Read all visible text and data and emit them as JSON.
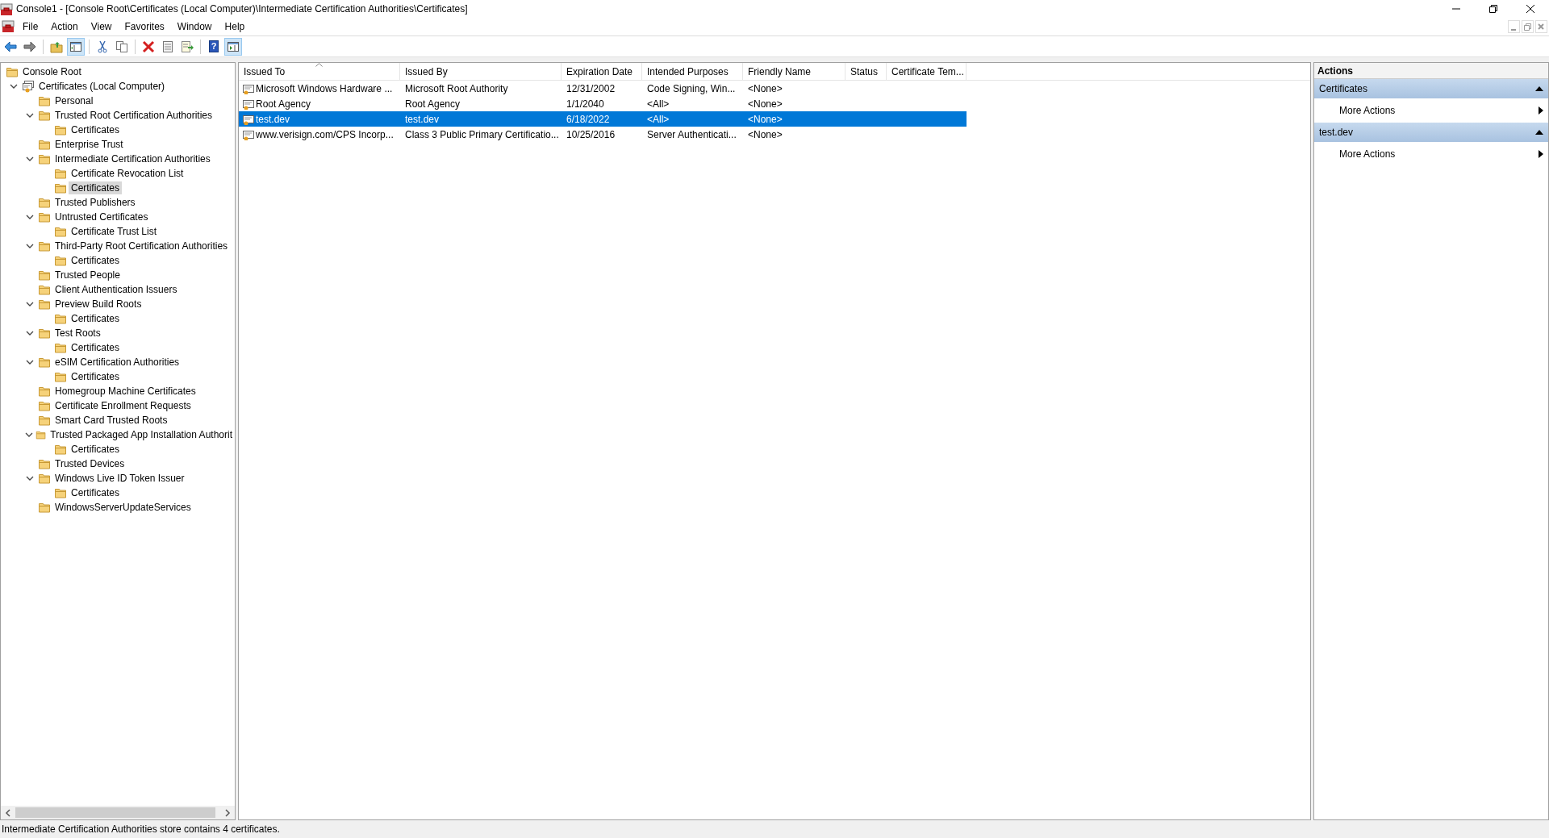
{
  "window": {
    "title": "Console1 - [Console Root\\Certificates (Local Computer)\\Intermediate Certification Authorities\\Certificates]"
  },
  "menu": [
    "File",
    "Action",
    "View",
    "Favorites",
    "Window",
    "Help"
  ],
  "toolbar": [
    {
      "kind": "back",
      "pressed": false
    },
    {
      "kind": "forward",
      "pressed": false
    },
    {
      "kind": "separator"
    },
    {
      "kind": "up",
      "pressed": false
    },
    {
      "kind": "tree",
      "pressed": true
    },
    {
      "kind": "separator"
    },
    {
      "kind": "cut",
      "pressed": false
    },
    {
      "kind": "copy",
      "pressed": false
    },
    {
      "kind": "separator"
    },
    {
      "kind": "delete",
      "pressed": false
    },
    {
      "kind": "properties",
      "pressed": false
    },
    {
      "kind": "export",
      "pressed": false
    },
    {
      "kind": "separator"
    },
    {
      "kind": "help",
      "pressed": false,
      "glyph": "?"
    },
    {
      "kind": "actionpane",
      "pressed": true
    }
  ],
  "tree": [
    {
      "label": "Console Root",
      "kind": "folder",
      "selected": false,
      "children": [
        {
          "label": "Certificates (Local Computer)",
          "kind": "store",
          "selected": false,
          "expanded": true,
          "children": [
            {
              "label": "Personal",
              "kind": "folder",
              "selected": false
            },
            {
              "label": "Trusted Root Certification Authorities",
              "kind": "folder",
              "selected": false,
              "expanded": true,
              "children": [
                {
                  "label": "Certificates",
                  "kind": "folder",
                  "selected": false
                }
              ]
            },
            {
              "label": "Enterprise Trust",
              "kind": "folder",
              "selected": false
            },
            {
              "label": "Intermediate Certification Authorities",
              "kind": "folder",
              "selected": false,
              "expanded": true,
              "children": [
                {
                  "label": "Certificate Revocation List",
                  "kind": "folder",
                  "selected": false
                },
                {
                  "label": "Certificates",
                  "kind": "folder",
                  "selected": true
                }
              ]
            },
            {
              "label": "Trusted Publishers",
              "kind": "folder",
              "selected": false
            },
            {
              "label": "Untrusted Certificates",
              "kind": "folder",
              "selected": false,
              "expanded": true,
              "children": [
                {
                  "label": "Certificate Trust List",
                  "kind": "folder",
                  "selected": false
                }
              ]
            },
            {
              "label": "Third-Party Root Certification Authorities",
              "kind": "folder",
              "selected": false,
              "expanded": true,
              "children": [
                {
                  "label": "Certificates",
                  "kind": "folder",
                  "selected": false
                }
              ]
            },
            {
              "label": "Trusted People",
              "kind": "folder",
              "selected": false
            },
            {
              "label": "Client Authentication Issuers",
              "kind": "folder",
              "selected": false
            },
            {
              "label": "Preview Build Roots",
              "kind": "folder",
              "selected": false,
              "expanded": true,
              "children": [
                {
                  "label": "Certificates",
                  "kind": "folder",
                  "selected": false
                }
              ]
            },
            {
              "label": "Test Roots",
              "kind": "folder",
              "selected": false,
              "expanded": true,
              "children": [
                {
                  "label": "Certificates",
                  "kind": "folder",
                  "selected": false
                }
              ]
            },
            {
              "label": "eSIM Certification Authorities",
              "kind": "folder",
              "selected": false,
              "expanded": true,
              "children": [
                {
                  "label": "Certificates",
                  "kind": "folder",
                  "selected": false
                }
              ]
            },
            {
              "label": "Homegroup Machine Certificates",
              "kind": "folder",
              "selected": false
            },
            {
              "label": "Certificate Enrollment Requests",
              "kind": "folder",
              "selected": false
            },
            {
              "label": "Smart Card Trusted Roots",
              "kind": "folder",
              "selected": false
            },
            {
              "label": "Trusted Packaged App Installation Authorit",
              "kind": "folder",
              "selected": false,
              "expanded": true,
              "children": [
                {
                  "label": "Certificates",
                  "kind": "folder",
                  "selected": false
                }
              ]
            },
            {
              "label": "Trusted Devices",
              "kind": "folder",
              "selected": false
            },
            {
              "label": "Windows Live ID Token Issuer",
              "kind": "folder",
              "selected": false,
              "expanded": true,
              "children": [
                {
                  "label": "Certificates",
                  "kind": "folder",
                  "selected": false
                }
              ]
            },
            {
              "label": "WindowsServerUpdateServices",
              "kind": "folder",
              "selected": false
            }
          ]
        }
      ]
    }
  ],
  "table": {
    "columns": [
      {
        "label": "Issued To",
        "sorted": true
      },
      {
        "label": "Issued By",
        "sorted": false
      },
      {
        "label": "Expiration Date",
        "sorted": false
      },
      {
        "label": "Intended Purposes",
        "sorted": false
      },
      {
        "label": "Friendly Name",
        "sorted": false
      },
      {
        "label": "Status",
        "sorted": false
      },
      {
        "label": "Certificate Tem...",
        "sorted": false
      }
    ],
    "rows": [
      {
        "selected": false,
        "cells": [
          "Microsoft Windows Hardware ...",
          "Microsoft Root Authority",
          "12/31/2002",
          "Code Signing, Win...",
          "<None>"
        ]
      },
      {
        "selected": false,
        "cells": [
          "Root Agency",
          "Root Agency",
          "1/1/2040",
          "<All>",
          "<None>"
        ]
      },
      {
        "selected": true,
        "cells": [
          "test.dev",
          "test.dev",
          "6/18/2022",
          "<All>",
          "<None>"
        ]
      },
      {
        "selected": false,
        "cells": [
          "www.verisign.com/CPS Incorp...",
          "Class 3 Public Primary Certificatio...",
          "10/25/2016",
          "Server Authenticati...",
          "<None>"
        ]
      }
    ]
  },
  "actions": {
    "title": "Actions",
    "groups": [
      {
        "label": "Certificates",
        "expanded": true,
        "items": [
          "More Actions"
        ]
      },
      {
        "label": "test.dev",
        "expanded": true,
        "items": [
          "More Actions"
        ]
      }
    ]
  },
  "status_bar": "Intermediate Certification Authorities store contains 4 certificates."
}
